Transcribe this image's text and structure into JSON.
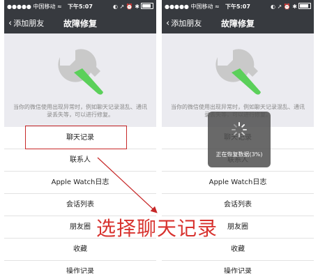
{
  "statusbar": {
    "carrier": "●●●●● 中国移动 ≈",
    "time": "下午5:07",
    "icons": "◐ ↗ ⏰ ✱"
  },
  "navbar": {
    "back_label": "添加朋友",
    "title": "故障修复"
  },
  "description": "当你的微信使用出现异常时，例如聊天记录混乱、通讯录丢失等，可以进行修复。",
  "list": [
    "聊天记录",
    "联系人",
    "Apple Watch日志",
    "会话列表",
    "朋友圈",
    "收藏",
    "操作记录"
  ],
  "loading": {
    "text": "正在恢复数据(3%)"
  },
  "caption": "选择聊天记录",
  "colors": {
    "nav": "#373a3f",
    "accent": "#d8332f",
    "wrench_green": "#5bd05a",
    "wrench_gray": "#c9c9c9"
  }
}
